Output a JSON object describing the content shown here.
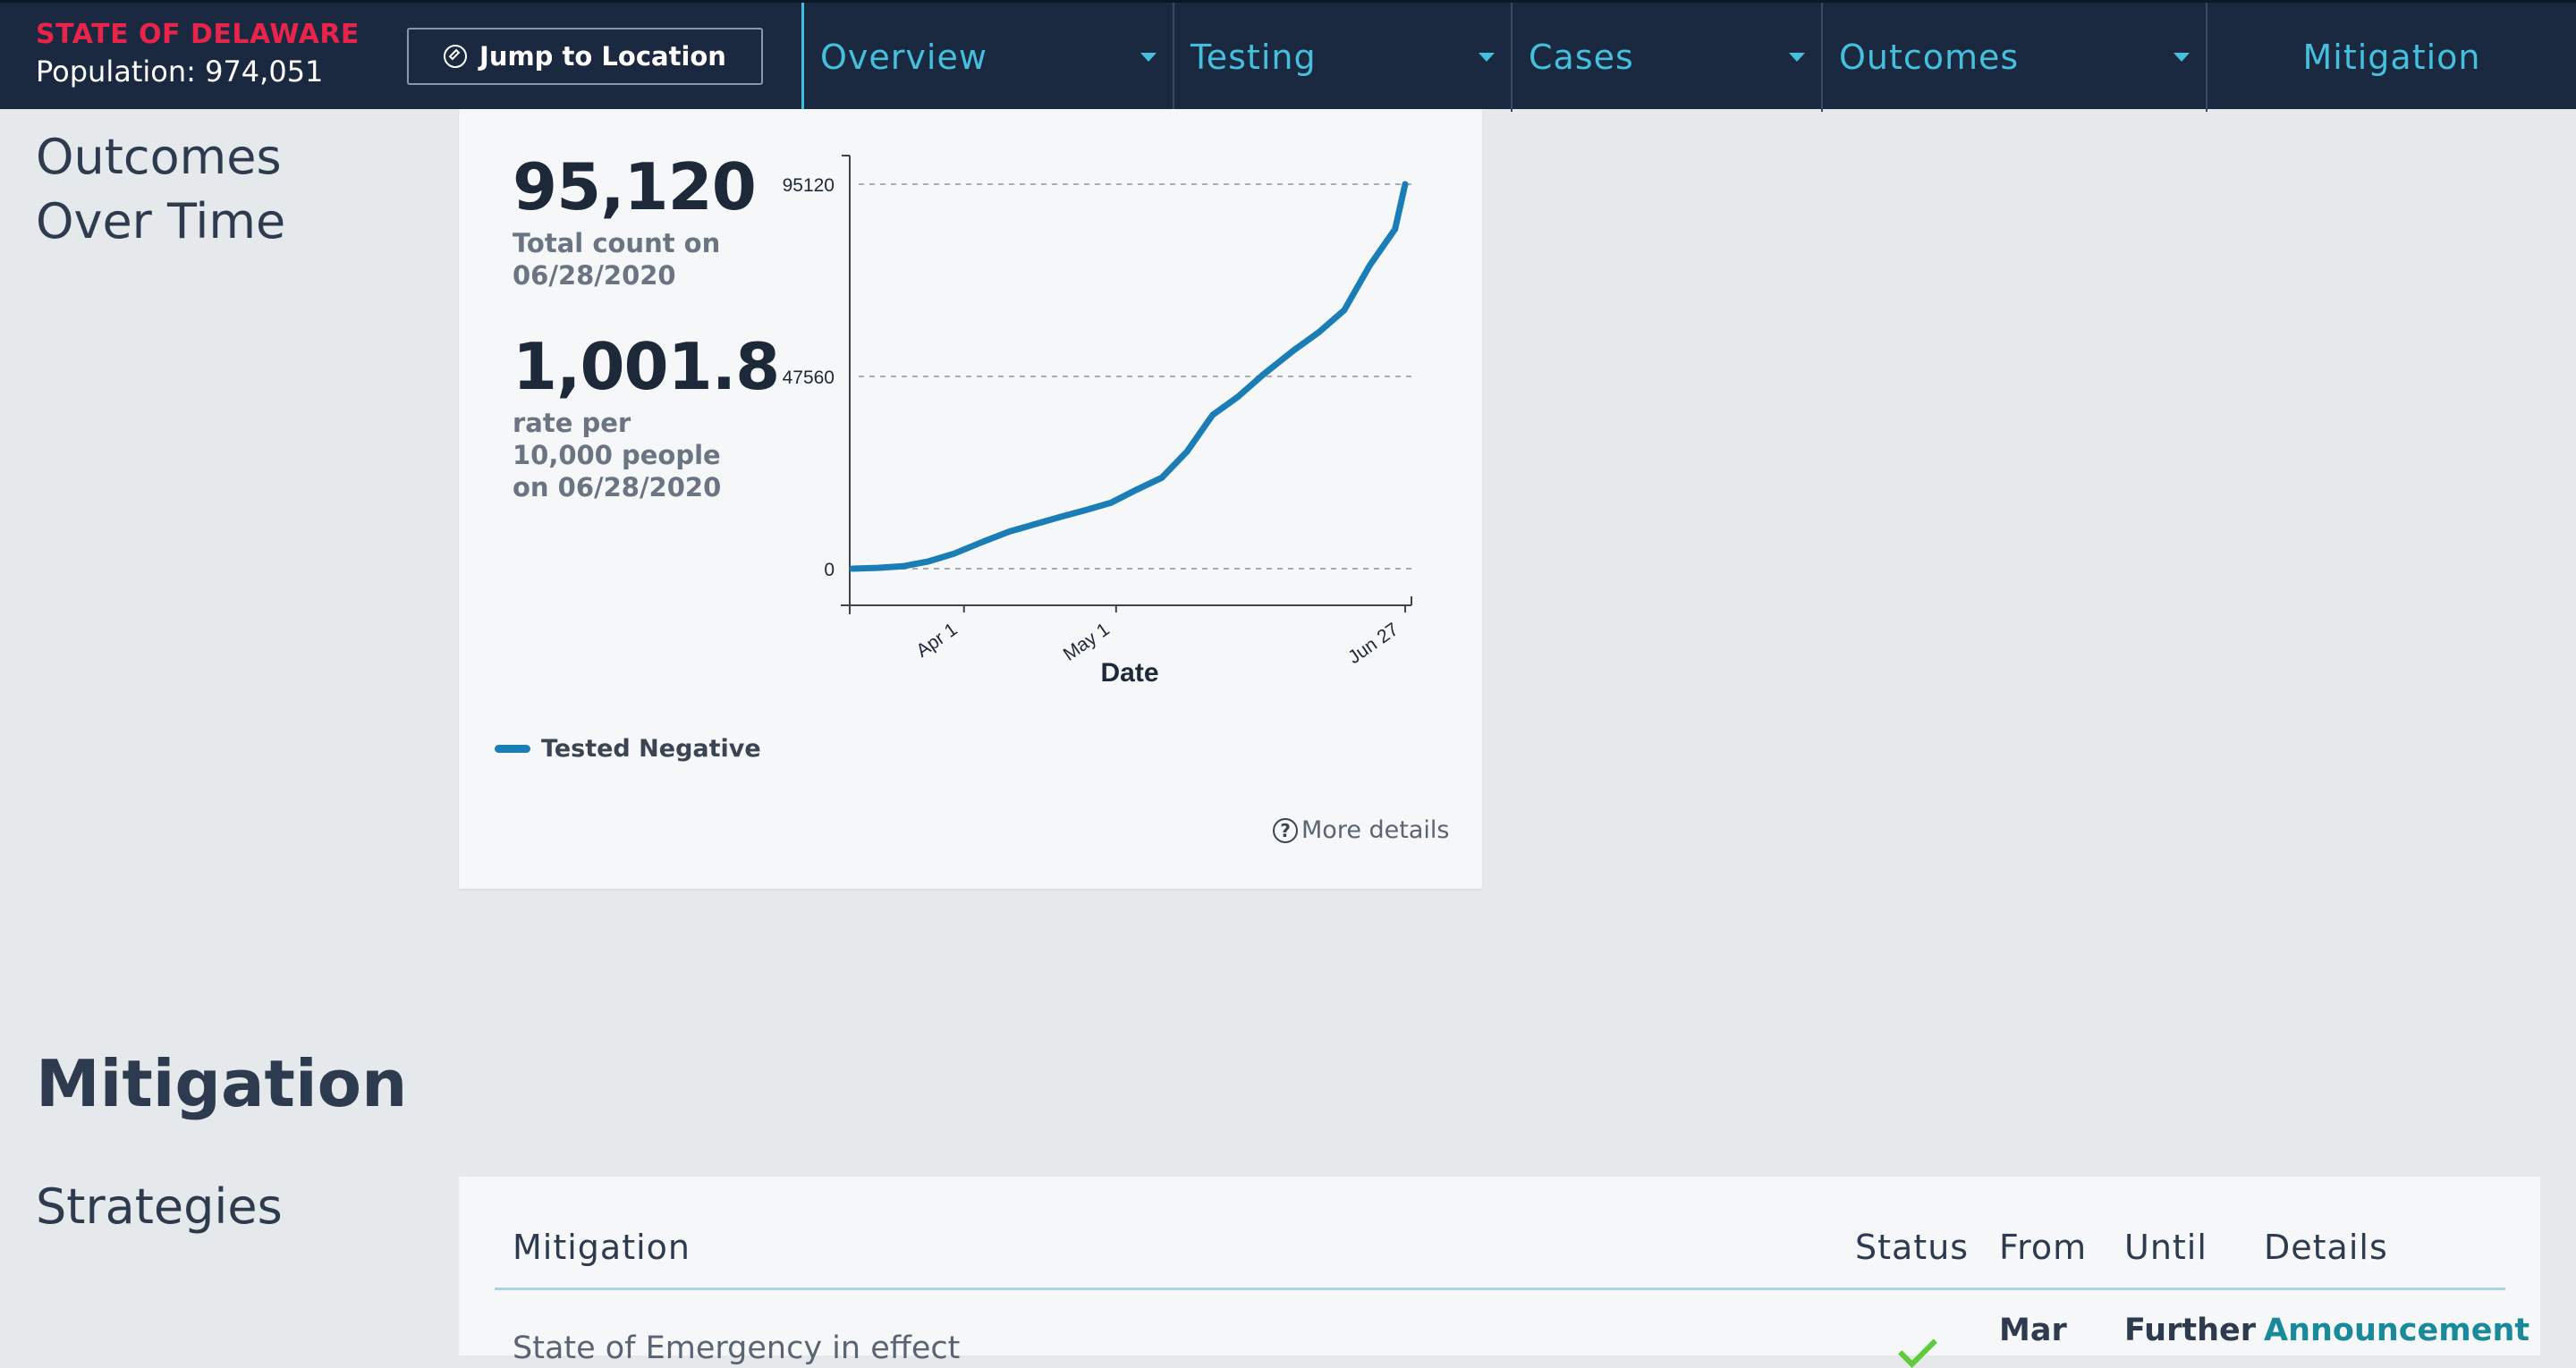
{
  "header": {
    "state_name": "STATE OF DELAWARE",
    "population": "Population: 974,051",
    "jump_button": {
      "label": "Jump to Location",
      "icon": "compass-icon"
    }
  },
  "nav": {
    "items": [
      {
        "label": "Overview",
        "has_dropdown": true
      },
      {
        "label": "Testing",
        "has_dropdown": true
      },
      {
        "label": "Cases",
        "has_dropdown": true
      },
      {
        "label": "Outcomes",
        "has_dropdown": true
      },
      {
        "label": "Mitigation",
        "has_dropdown": false
      }
    ],
    "accent_color": "#45c0dc"
  },
  "outcomes": {
    "section_title": "Outcomes Over Time",
    "total_value": "95,120",
    "total_label_line1": "Total count on",
    "total_label_line2": "06/28/2020",
    "rate_value": "1,001.8",
    "rate_label_line1": "rate per",
    "rate_label_line2": "10,000 people",
    "rate_label_line3": "on 06/28/2020",
    "legend_label": "Tested Negative",
    "more_details": "More details"
  },
  "chart_data": {
    "type": "line",
    "title": "",
    "xlabel": "Date",
    "ylabel": "",
    "y_ticks": [
      "0",
      "47560",
      "95120"
    ],
    "x_ticks": [
      "Apr 1",
      "May 1",
      "Jun 27"
    ],
    "grid": "horizontal dashed",
    "legend_placement": "bottom-left",
    "series_color": "#1a7db5",
    "ylim": [
      0,
      95120
    ],
    "series": [
      {
        "name": "Tested Negative",
        "x": [
          "2020-03-10",
          "2020-03-15",
          "2020-03-20",
          "2020-03-25",
          "2020-03-30",
          "2020-04-05",
          "2020-04-10",
          "2020-04-15",
          "2020-04-20",
          "2020-04-25",
          "2020-04-30",
          "2020-05-05",
          "2020-05-10",
          "2020-05-15",
          "2020-05-20",
          "2020-05-25",
          "2020-05-30",
          "2020-06-05",
          "2020-06-10",
          "2020-06-15",
          "2020-06-20",
          "2020-06-25",
          "2020-06-27"
        ],
        "values": [
          0,
          200,
          600,
          1800,
          3700,
          6800,
          9200,
          11000,
          12800,
          14500,
          16300,
          19500,
          22500,
          29000,
          38000,
          42500,
          48000,
          54000,
          58500,
          64000,
          75000,
          84000,
          95120
        ]
      }
    ]
  },
  "mitigation": {
    "section_title": "Mitigation",
    "subsection_title": "Strategies",
    "table": {
      "headers": [
        "Mitigation",
        "Status",
        "From",
        "Until",
        "Details"
      ],
      "rows": [
        {
          "mitigation": "State of Emergency in effect",
          "status": "active",
          "from": "Mar",
          "until": "Further",
          "details": "Announcement"
        }
      ]
    }
  }
}
